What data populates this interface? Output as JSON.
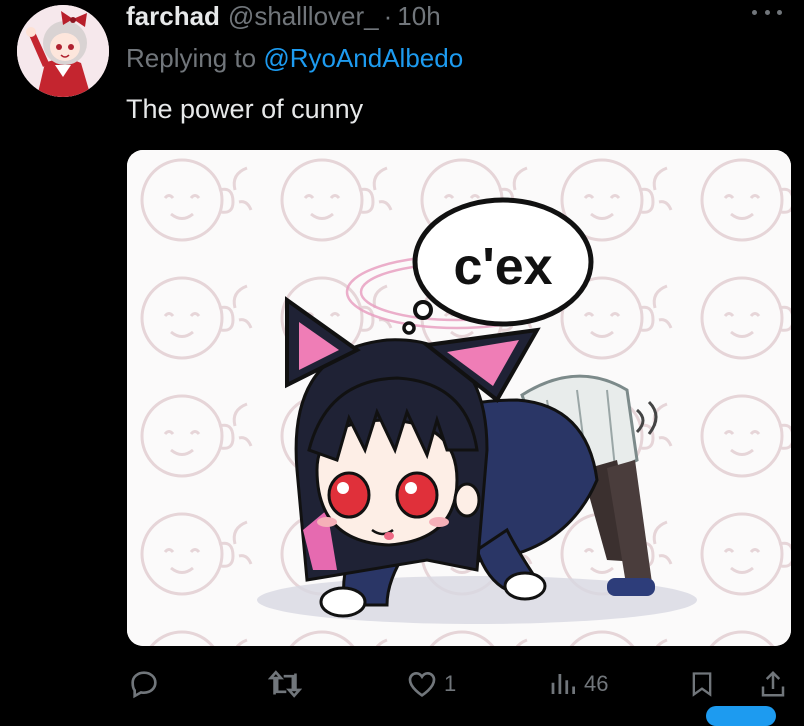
{
  "tweet": {
    "display_name": "farchad",
    "handle": "@shalllover_",
    "separator": "·",
    "time": "10h",
    "replying_prefix": "Replying to ",
    "replying_to": "@RyoAndAlbedo",
    "text": "The power of cunny",
    "media": {
      "speech_bubble_text": "c'ex"
    }
  },
  "actions": {
    "reply_icon": "reply-icon",
    "retweet_icon": "retweet-icon",
    "like_icon": "heart-icon",
    "like_count": "1",
    "views_icon": "views-icon",
    "views_count": "46",
    "bookmark_icon": "bookmark-icon",
    "share_icon": "share-icon"
  },
  "colors": {
    "background": "#000000",
    "text_primary": "#e7e9ea",
    "text_secondary": "#71767b",
    "accent": "#1d9bf0"
  }
}
